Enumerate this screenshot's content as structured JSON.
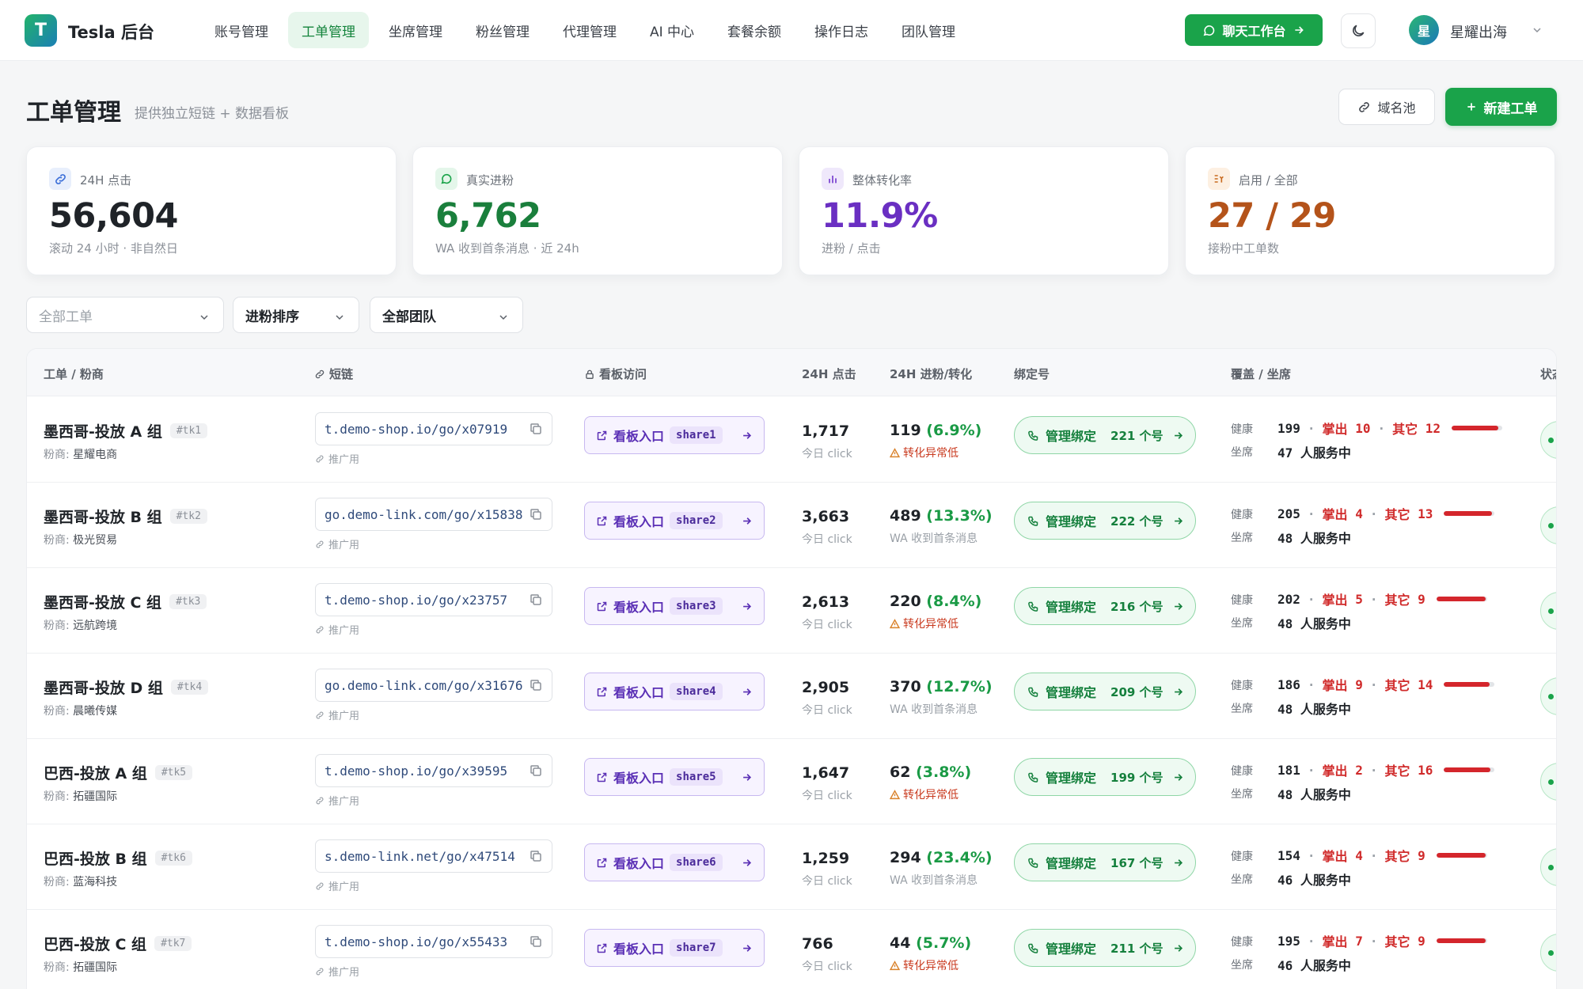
{
  "brand": {
    "logo_letter": "T",
    "name": "Tesla 后台"
  },
  "nav": [
    {
      "label": "账号管理",
      "active": false
    },
    {
      "label": "工单管理",
      "active": true
    },
    {
      "label": "坐席管理",
      "active": false
    },
    {
      "label": "粉丝管理",
      "active": false
    },
    {
      "label": "代理管理",
      "active": false
    },
    {
      "label": "AI 中心",
      "active": false
    },
    {
      "label": "套餐余额",
      "active": false
    },
    {
      "label": "操作日志",
      "active": false
    },
    {
      "label": "团队管理",
      "active": false
    }
  ],
  "header_actions": {
    "chat_label": "聊天工作台",
    "user_initial": "星",
    "user_name": "星耀出海"
  },
  "page": {
    "title": "工单管理",
    "subtitle": "提供独立短链 + 数据看板",
    "domain_pool_label": "域名池",
    "new_ticket_label": "新建工单"
  },
  "stats": [
    {
      "label": "24H 点击",
      "value": "56,604",
      "note": "滚动 24 小时 · 非自然日",
      "color": "#1f2328",
      "icon": "link-icon",
      "icon_color": "#3b6fd8",
      "icon_bg": "#e8effc"
    },
    {
      "label": "真实进粉",
      "value": "6,762",
      "note": "WA 收到首条消息 · 近 24h",
      "color": "#1a7f3c",
      "icon": "chat-bubble-icon",
      "icon_color": "#1aa34a",
      "icon_bg": "#e4f6ea"
    },
    {
      "label": "整体转化率",
      "value": "11.9%",
      "note": "进粉 / 点击",
      "color": "#6a2fc2",
      "icon": "bar-chart-icon",
      "icon_color": "#7b45d1",
      "icon_bg": "#efe8fb"
    },
    {
      "label": "启用 / 全部",
      "value": "27 / 29",
      "note": "接粉中工单数",
      "color": "#b4531a",
      "icon": "list-toggle-icon",
      "icon_color": "#c86a1e",
      "icon_bg": "#fdf0e2"
    }
  ],
  "filters": [
    {
      "value": "全部工单",
      "placeholder": true
    },
    {
      "value": "进粉排序",
      "placeholder": false
    },
    {
      "value": "全部团队",
      "placeholder": false
    }
  ],
  "columns": {
    "name": "工单 / 粉商",
    "link": "短链",
    "board": "看板访问",
    "clicks": "24H 点击",
    "conv": "24H 进粉/转化",
    "bind": "绑定号",
    "cover": "覆盖 / 坐席",
    "status": "状态"
  },
  "labels": {
    "merchant_prefix": "粉商:",
    "promo": "推广用",
    "board_entry": "看板入口",
    "clicks_unit": "今日 click",
    "bind": "管理绑定",
    "health": "健康",
    "seat": "坐席",
    "lost": "掌出",
    "other": "其它",
    "serving_suffix": "人服务中"
  },
  "rows": [
    {
      "name": "墨西哥-投放 A 组",
      "tag": "#tk1",
      "merchant": "星耀电商",
      "link": "t.demo-shop.io/go/x07919",
      "share": "share1",
      "clicks": "1,717",
      "fans": "119",
      "rate": "(6.9%)",
      "conv_note": "转化异常低",
      "warn": true,
      "bind": "221 个号",
      "health": "199",
      "lost": "10",
      "other": "12",
      "seats": "47",
      "bar_fill": 0.92
    },
    {
      "name": "墨西哥-投放 B 组",
      "tag": "#tk2",
      "merchant": "极光贸易",
      "link": "go.demo-link.com/go/x15838",
      "share": "share2",
      "clicks": "3,663",
      "fans": "489",
      "rate": "(13.3%)",
      "conv_note": "WA 收到首条消息",
      "warn": false,
      "bind": "222 个号",
      "health": "205",
      "lost": "4",
      "other": "13",
      "seats": "48",
      "bar_fill": 0.95
    },
    {
      "name": "墨西哥-投放 C 组",
      "tag": "#tk3",
      "merchant": "远航跨境",
      "link": "t.demo-shop.io/go/x23757",
      "share": "share3",
      "clicks": "2,613",
      "fans": "220",
      "rate": "(8.4%)",
      "conv_note": "转化异常低",
      "warn": true,
      "bind": "216 个号",
      "health": "202",
      "lost": "5",
      "other": "9",
      "seats": "48",
      "bar_fill": 0.97
    },
    {
      "name": "墨西哥-投放 D 组",
      "tag": "#tk4",
      "merchant": "晨曦传媒",
      "link": "go.demo-link.com/go/x31676",
      "share": "share4",
      "clicks": "2,905",
      "fans": "370",
      "rate": "(12.7%)",
      "conv_note": "WA 收到首条消息",
      "warn": false,
      "bind": "209 个号",
      "health": "186",
      "lost": "9",
      "other": "14",
      "seats": "48",
      "bar_fill": 0.9
    },
    {
      "name": "巴西-投放 A 组",
      "tag": "#tk5",
      "merchant": "拓疆国际",
      "link": "t.demo-shop.io/go/x39595",
      "share": "share5",
      "clicks": "1,647",
      "fans": "62",
      "rate": "(3.8%)",
      "conv_note": "转化异常低",
      "warn": true,
      "bind": "199 个号",
      "health": "181",
      "lost": "2",
      "other": "16",
      "seats": "48",
      "bar_fill": 0.92
    },
    {
      "name": "巴西-投放 B 组",
      "tag": "#tk6",
      "merchant": "蓝海科技",
      "link": "s.demo-link.net/go/x47514",
      "share": "share6",
      "clicks": "1,259",
      "fans": "294",
      "rate": "(23.4%)",
      "conv_note": "WA 收到首条消息",
      "warn": false,
      "bind": "167 个号",
      "health": "154",
      "lost": "4",
      "other": "9",
      "seats": "46",
      "bar_fill": 0.97
    },
    {
      "name": "巴西-投放 C 组",
      "tag": "#tk7",
      "merchant": "拓疆国际",
      "link": "t.demo-shop.io/go/x55433",
      "share": "share7",
      "clicks": "766",
      "fans": "44",
      "rate": "(5.7%)",
      "conv_note": "转化异常低",
      "warn": true,
      "bind": "211 个号",
      "health": "195",
      "lost": "7",
      "other": "9",
      "seats": "46",
      "bar_fill": 0.97
    }
  ]
}
